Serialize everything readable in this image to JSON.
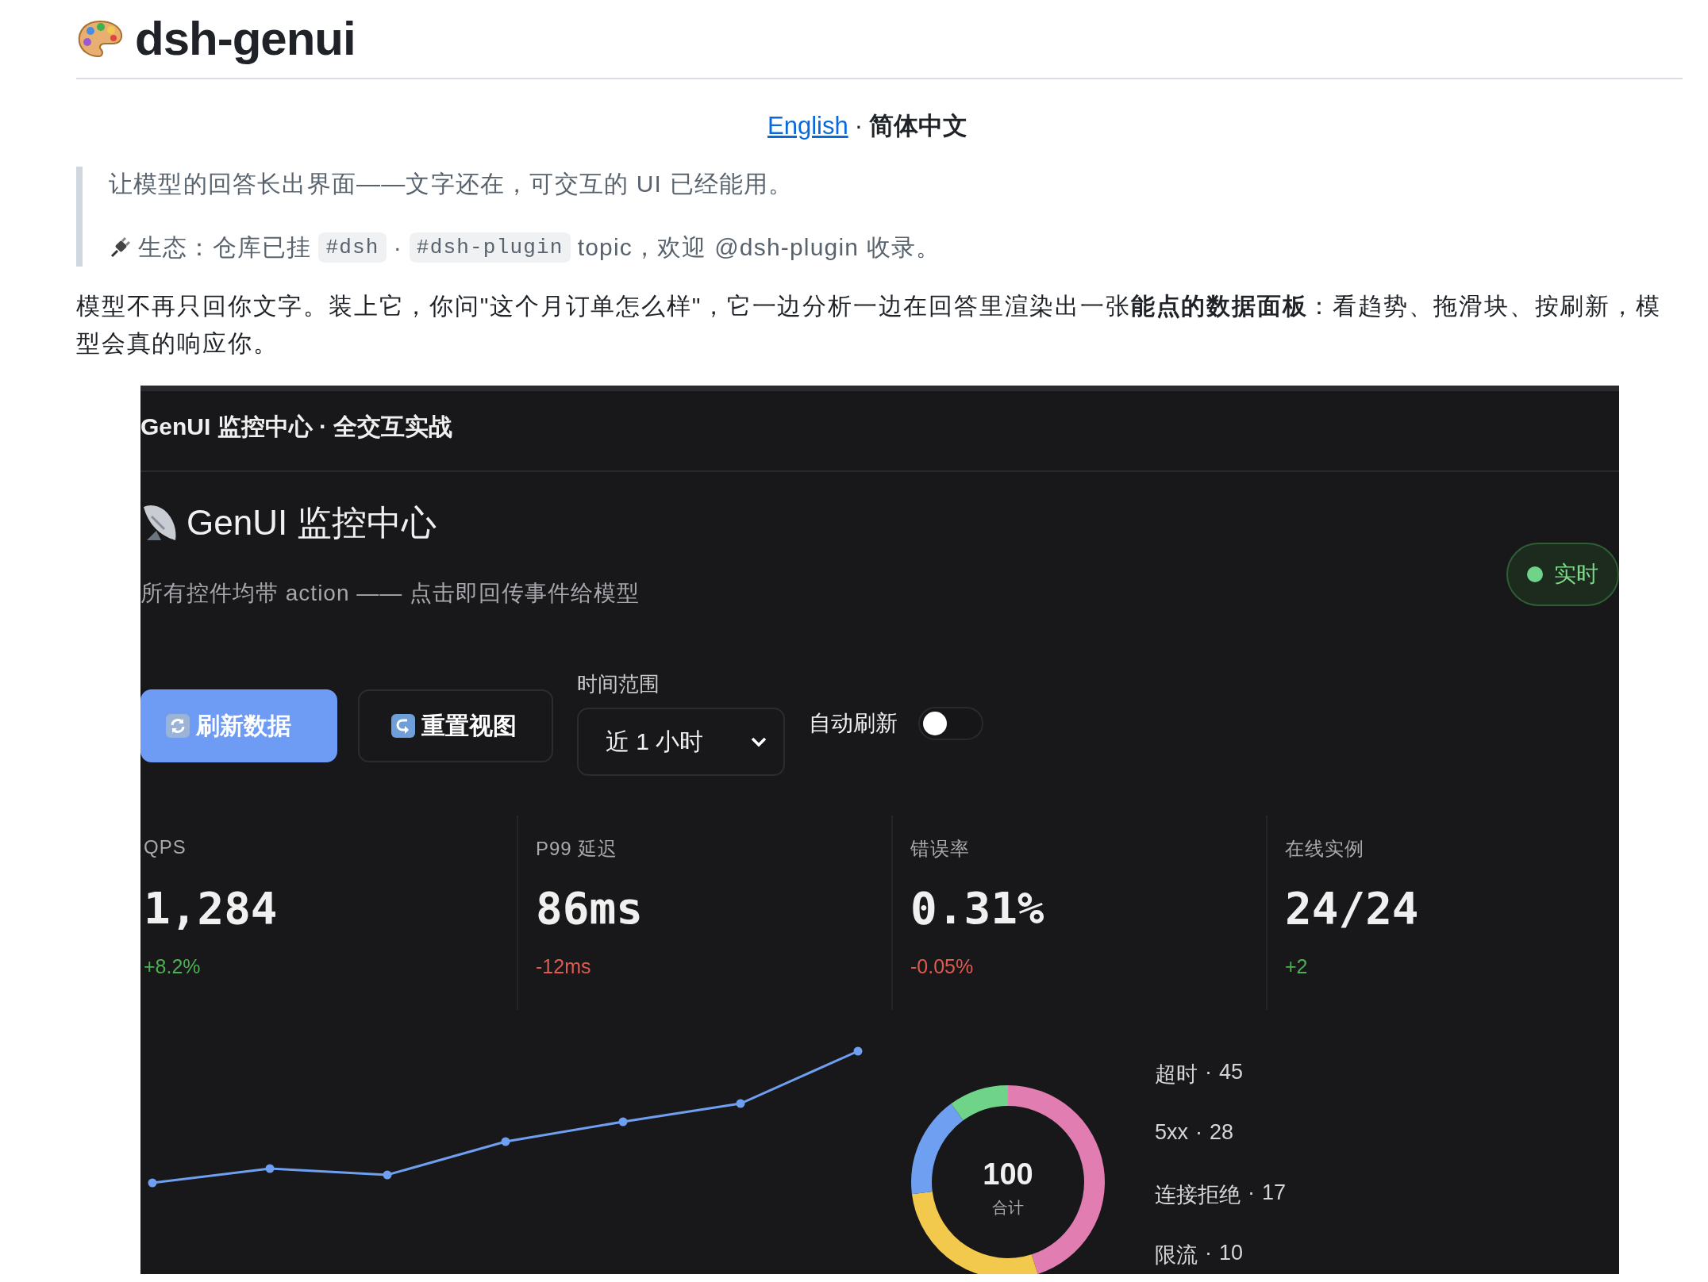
{
  "readme": {
    "title": "dsh-genui",
    "lang_links": [
      {
        "label": "English",
        "selected": false
      },
      {
        "label": "简体中文",
        "selected": true
      }
    ],
    "lang_separator": "·",
    "tagline": "让模型的回答长出界面——文字还在，可交互的 UI 已经能用。",
    "ecosystem": [
      {
        "kind": "text",
        "text": "生态：仓库已挂"
      },
      {
        "kind": "code",
        "text": "#dsh"
      },
      {
        "kind": "text",
        "text": "·"
      },
      {
        "kind": "code",
        "text": "#dsh-plugin"
      },
      {
        "kind": "text",
        "text": "topic，欢迎 @dsh-plugin 收录。"
      }
    ],
    "intro": "模型不再只回你文字。装上它，你问\"这个月订单怎么样\"，它一边分析一边在回答里渲染出一张**能点的数据面板**：看趋势、拖滑块、按刷新，模型会真的响应你。"
  },
  "dashboard": {
    "window_title": "GenUI 监控中心 · 全交互实战",
    "title": "GenUI 监控中心",
    "subtitle": "所有控件均带 action —— 点击即回传事件给模型",
    "status_badge": {
      "label": "实时",
      "on": true
    },
    "buttons": [
      {
        "label": "刷新数据",
        "kind": "primary"
      },
      {
        "label": "重置视图",
        "kind": "secondary"
      }
    ],
    "time_range": {
      "label": "时间范围",
      "value": "近 1 小时"
    },
    "auto_refresh": {
      "label": "自动刷新",
      "on": false
    },
    "metrics": [
      {
        "label": "QPS",
        "value": "1,284",
        "delta": "+8.2%",
        "color": "#4caf50"
      },
      {
        "label": "P99 延迟",
        "value": "86ms",
        "delta": "-12ms",
        "color": "#e05a4f"
      },
      {
        "label": "错误率",
        "value": "0.31%",
        "delta": "-0.05%",
        "color": "#e05a4f"
      },
      {
        "label": "在线实例",
        "value": "24/24",
        "delta": "+2",
        "color": "#4caf50"
      }
    ],
    "errors": {
      "center_value": "100",
      "center_label": "合计",
      "legend_separator": "·",
      "chart_data": {
        "type": "donut",
        "value_labels": [
          "45",
          "28",
          "17",
          "10"
        ],
        "categories": [
          "超时",
          "5xx",
          "连接拒绝",
          "限流"
        ],
        "values": [
          45,
          28,
          17,
          10
        ],
        "colors": [
          "#e27db1",
          "#f2c94c",
          "#6f9ff0",
          "#6fd389"
        ]
      }
    }
  }
}
